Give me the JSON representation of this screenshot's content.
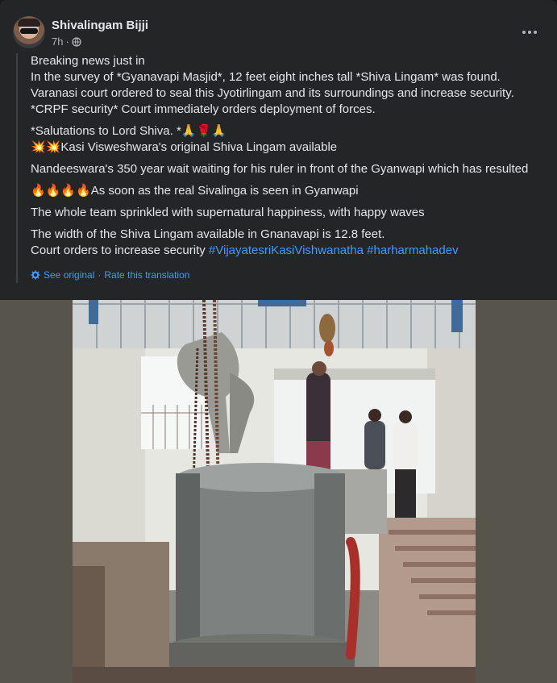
{
  "post": {
    "author": "Shivalingam Bijji",
    "time": "7h",
    "privacy_icon": "globe-icon",
    "menu_icon": "more-horizontal-icon"
  },
  "body": {
    "paragraphs": [
      "Breaking news just in\nIn the survey of *Gyanavapi Masjid*, 12 feet eight inches tall *Shiva Lingam* was found.\nVaranasi court ordered to seal this Jyotirlingam and its surroundings and increase security.\n*CRPF security* Court immediately orders deployment of forces.",
      "*Salutations to Lord Shiva. *🙏🌹🙏\n💥💥Kasi Visweshwara's original Shiva Lingam available",
      "Nandeeswara's 350 year wait waiting for his ruler in front of the Gyanwapi which has resulted",
      "🔥🔥🔥🔥As soon as the real Sivalinga is seen in Gyanwapi",
      "The whole team sprinkled with supernatural happiness, with happy waves"
    ],
    "last_line1": "The width of the Shiva Lingam available in Gnanavapi is 12.8 feet.",
    "last_line2_prefix": "Court orders to increase security ",
    "hashtag1": "#VijayatesriKasiVishwanatha",
    "hashtag2": "#harharmahadev"
  },
  "translation": {
    "see_original": "See original",
    "separator": "·",
    "rate": "Rate this translation",
    "icon": "gear-icon"
  },
  "photo": {
    "description_icon": "photo-image"
  }
}
